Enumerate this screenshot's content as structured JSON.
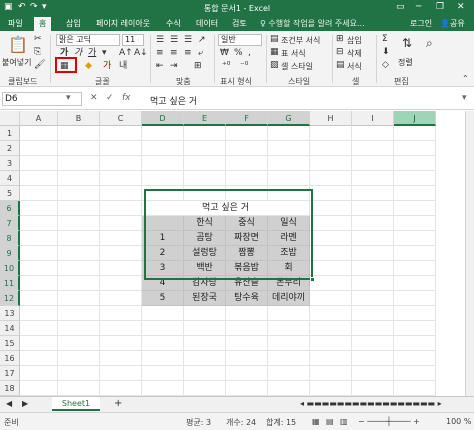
{
  "window": {
    "title": "통합 문서1 - Excel",
    "qat_icons": [
      "save-icon",
      "undo-icon",
      "redo-icon",
      "customize-icon"
    ],
    "controls": [
      "ribbon-display-icon",
      "minimize-icon",
      "restore-icon",
      "close-icon"
    ]
  },
  "tabs": [
    "파일",
    "홈",
    "삽입",
    "페이지 레이아웃",
    "수식",
    "데이터",
    "검토",
    "보기"
  ],
  "active_tab": "홈",
  "tellme": "수행할 작업을 알려 주세요...",
  "signin": "로그인",
  "share": "공유",
  "ribbon": {
    "clipboard": {
      "label": "클립보드",
      "paste": "붙여넣기"
    },
    "font": {
      "label": "글꼴",
      "name": "맑은 고딕",
      "size": "11",
      "bold": "가",
      "italic": "가",
      "underline": "가"
    },
    "alignment": {
      "label": "맞춤"
    },
    "number": {
      "label": "표시 형식",
      "format": "일반",
      "currency": "₩",
      "percent": "%",
      "comma": ","
    },
    "styles": {
      "label": "스타일",
      "conditional": "조건부 서식",
      "table": "표 서식",
      "cell": "셀 스타일"
    },
    "cells": {
      "label": "셀",
      "insert": "삽입",
      "delete": "삭제",
      "format": "서식"
    },
    "editing": {
      "label": "편집",
      "sigma": "Σ",
      "sort": "정렬"
    }
  },
  "formula_bar": {
    "name_box": "D6",
    "cancel": "✕",
    "enter": "✓",
    "fx": "fx",
    "value": "먹고 싶은 거"
  },
  "columns": [
    "A",
    "B",
    "C",
    "D",
    "E",
    "F",
    "G",
    "H",
    "I",
    "J"
  ],
  "rows": [
    "1",
    "2",
    "3",
    "4",
    "5",
    "6",
    "7",
    "8",
    "9",
    "10",
    "11",
    "12",
    "13",
    "14",
    "15",
    "16",
    "17",
    "18"
  ],
  "table": {
    "title": "먹고 싶은 거",
    "headers": [
      "",
      "한식",
      "중식",
      "일식"
    ],
    "rows": [
      [
        "1",
        "곰탕",
        "짜장면",
        "라멘"
      ],
      [
        "2",
        "설렁탕",
        "짬뽕",
        "조밥"
      ],
      [
        "3",
        "백반",
        "볶음밥",
        "회"
      ],
      [
        "4",
        "감자탕",
        "유산슬",
        "돈부리"
      ],
      [
        "5",
        "된장국",
        "탕수육",
        "데리야끼"
      ]
    ]
  },
  "sheet_tab": "Sheet1",
  "add_sheet": "+",
  "status": {
    "ready": "준비",
    "average": "평균: 3",
    "count": "개수: 24",
    "sum": "합계: 15",
    "zoom": "100 %"
  },
  "colors": {
    "excel_green": "#217346",
    "highlight_red": "#e00000",
    "grey_fill": "#d0d0d0"
  }
}
